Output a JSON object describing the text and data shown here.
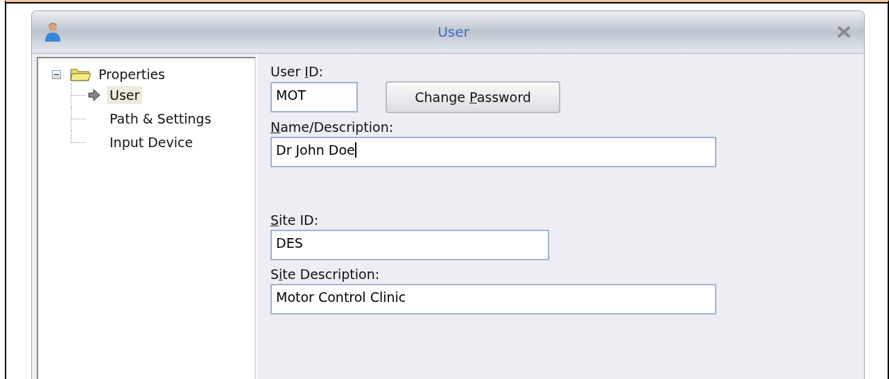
{
  "window": {
    "title": "User"
  },
  "tree": {
    "label": "Properties",
    "expanded": true,
    "children": [
      {
        "label": "User",
        "selected": true
      },
      {
        "label": "Path & Settings",
        "selected": false
      },
      {
        "label": "Input Device",
        "selected": false
      }
    ]
  },
  "form": {
    "fields": [
      {
        "kind": "short",
        "label": {
          "before": "User ",
          "key": "I",
          "after": "D:"
        },
        "value": "MOT",
        "button": {
          "label": {
            "before": "Change ",
            "key": "P",
            "after": "assword"
          }
        }
      },
      {
        "kind": "wide",
        "label": {
          "key": "N",
          "after": "ame/Description:"
        },
        "value": "Dr John Doe",
        "focused": true
      },
      {
        "kind": "medium",
        "label": {
          "key": "S",
          "after": "ite ID:"
        },
        "value": "DES"
      },
      {
        "kind": "wide",
        "label": {
          "before": "S",
          "key": "i",
          "after": "te Description:"
        },
        "value": "Motor Control Clinic"
      }
    ]
  }
}
